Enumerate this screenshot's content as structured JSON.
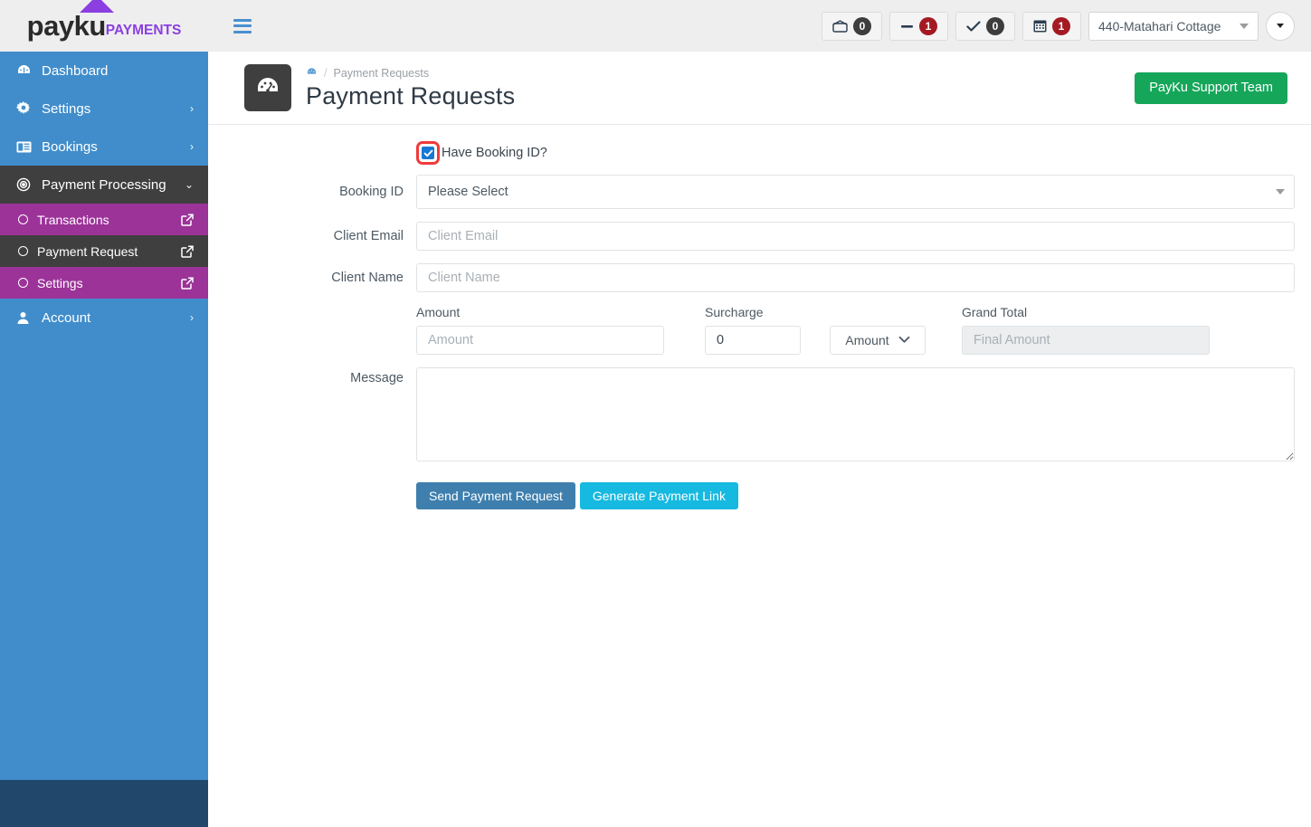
{
  "brand": {
    "name_primary": "payku",
    "name_secondary": "PAYMENTS",
    "triangle_color": "#8b3fe0"
  },
  "topbar": {
    "menu_toggle": "hamburger-menu",
    "badges": [
      {
        "icon": "envelope-icon",
        "count": "0",
        "style": "dark"
      },
      {
        "icon": "minus-icon",
        "count": "1",
        "style": "red"
      },
      {
        "icon": "check-icon",
        "count": "0",
        "style": "dark"
      },
      {
        "icon": "calendar-icon",
        "count": "1",
        "style": "red"
      }
    ],
    "site_select": {
      "value": "440-Matahari Cottage"
    },
    "user_caret": "caret-down"
  },
  "sidebar": {
    "items": [
      {
        "label": "Dashboard",
        "icon": "dashboard-icon",
        "arrow": "",
        "active": false
      },
      {
        "label": "Settings",
        "icon": "gear-icon",
        "arrow": "›",
        "active": false
      },
      {
        "label": "Bookings",
        "icon": "bookings-icon",
        "arrow": "›",
        "active": false
      },
      {
        "label": "Payment Processing",
        "icon": "target-icon",
        "arrow": "⌄",
        "active": true
      }
    ],
    "submenu": [
      {
        "label": "Transactions",
        "active": false
      },
      {
        "label": "Payment Request",
        "active": true
      },
      {
        "label": "Settings",
        "active": false
      }
    ],
    "account": {
      "label": "Account",
      "icon": "user-icon",
      "arrow": "›"
    },
    "colors": {
      "base": "#418dcb",
      "active": "#3f3f3f",
      "submenu": "#9c3399",
      "footer": "#21486b"
    }
  },
  "page": {
    "icon": "speedometer-icon",
    "breadcrumb_home_icon": "dashboard-icon",
    "breadcrumb_separator": "/",
    "breadcrumb_current": "Payment Requests",
    "title": "Payment Requests",
    "support_button": "PayKu Support Team",
    "support_button_color": "#16a65a"
  },
  "form": {
    "have_booking_id": {
      "label": "Have Booking ID?",
      "checked": true,
      "highlight_color": "#ef3b3b",
      "checkbox_color": "#1877d2"
    },
    "booking_id": {
      "label": "Booking ID",
      "selected": "Please Select"
    },
    "client_email": {
      "label": "Client Email",
      "value": "",
      "placeholder": "Client Email"
    },
    "client_name": {
      "label": "Client Name",
      "value": "",
      "placeholder": "Client Name"
    },
    "amount": {
      "caption": "Amount",
      "value": "",
      "placeholder": "Amount"
    },
    "surcharge": {
      "caption": "Surcharge",
      "value": "0",
      "placeholder": "0"
    },
    "surcharge_type": {
      "selected": "Amount"
    },
    "grand_total": {
      "caption": "Grand Total",
      "value": "",
      "placeholder": "Final Amount",
      "disabled": true
    },
    "message": {
      "label": "Message",
      "value": "",
      "placeholder": ""
    },
    "buttons": {
      "send": {
        "label": "Send Payment Request",
        "color": "#3e7fae"
      },
      "generate": {
        "label": "Generate Payment Link",
        "color": "#16b9e0"
      }
    }
  }
}
